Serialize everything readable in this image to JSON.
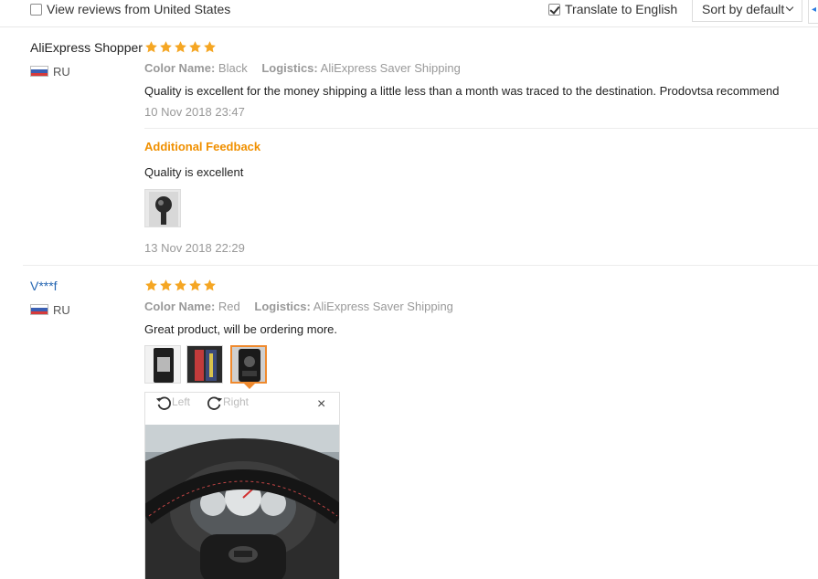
{
  "toolbar": {
    "view_us_label": "View reviews from United States",
    "view_us_checked": false,
    "translate_label": "Translate to English",
    "translate_checked": true,
    "sort_label": "Sort by default"
  },
  "reviews": [
    {
      "user": "AliExpress Shopper",
      "country": "RU",
      "rating": 5,
      "color_label": "Color Name:",
      "color_value": "Black",
      "logistics_label": "Logistics:",
      "logistics_value": "AliExpress Saver Shipping",
      "feedback": "Quality is excellent for the money shipping a little less than a month was traced to the destination. Prodovtsa recommend",
      "date": "10 Nov 2018 23:47",
      "additional_title": "Additional Feedback",
      "additional_text": "Quality is excellent",
      "additional_date": "13 Nov 2018 22:29"
    },
    {
      "user": "V***f",
      "country": "RU",
      "rating": 5,
      "color_label": "Color Name:",
      "color_value": "Red",
      "logistics_label": "Logistics:",
      "logistics_value": "AliExpress Saver Shipping",
      "feedback": "Great product, will be ordering more."
    }
  ],
  "viewer": {
    "left_label": "Left",
    "right_label": "Right",
    "close_symbol": "×"
  },
  "colors": {
    "star": "#f5a623",
    "accent_orange": "#f09000",
    "link_blue": "#2767b3"
  }
}
